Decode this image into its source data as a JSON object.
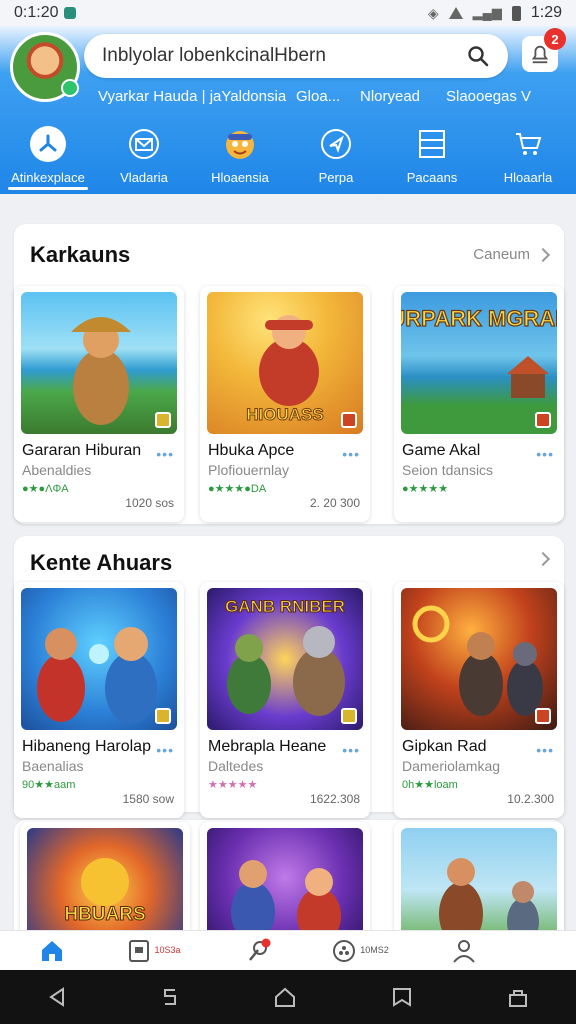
{
  "status": {
    "time_left": "0:1:20",
    "time_right": "1:29"
  },
  "search": {
    "placeholder": "Inblyolar lobenkcinalHbern"
  },
  "notifications": {
    "count": "2"
  },
  "header_links": [
    "Vyarkar Hauda | jaYaldonsia",
    "Gloa...",
    "Nloryead",
    "Slaooegas V"
  ],
  "categories": [
    {
      "label": "Atinkexplace",
      "icon": "marketplace-icon",
      "active": true
    },
    {
      "label": "Vladaria",
      "icon": "mail-icon"
    },
    {
      "label": "Hloaensia",
      "icon": "game-mascot-icon"
    },
    {
      "label": "Perpa",
      "icon": "compass-icon"
    },
    {
      "label": "Pacaans",
      "icon": "list-icon"
    },
    {
      "label": "Hloaarla",
      "icon": "cart-icon"
    }
  ],
  "sections": [
    {
      "title": "Karkauns",
      "more": "Caneum",
      "games": [
        {
          "name": "Gararan Hiburan",
          "sub": "Abenaldies",
          "rating": "●★●ΛΦA",
          "count": "1020 sos",
          "art_text": ""
        },
        {
          "name": "Hbuka Apce",
          "sub": "Plofiouernlay",
          "rating": "●★★★●DA",
          "count": "2. 20 300",
          "art_text": "HIOUASS"
        },
        {
          "name": "Game Akal",
          "sub": "Seion tdansics",
          "rating": "●★★★★",
          "count": "",
          "art_text": "KURPARK MGRAES"
        }
      ]
    },
    {
      "title": "Kente Ahuars",
      "more": "",
      "games": [
        {
          "name": "Hibaneng Harolap",
          "sub": "Baenalias",
          "rating": "90★★aam",
          "count": "1580 sow",
          "art_text": ""
        },
        {
          "name": "Mebrapla Heane",
          "sub": "Daltedes",
          "rating": "★★★★★",
          "count": "1622.308",
          "art_text": "GANB RNIBER"
        },
        {
          "name": "Gipkan Rad",
          "sub": "Dameriolamkag",
          "rating": "0h★★loam",
          "count": "10.2.300",
          "art_text": ""
        }
      ]
    },
    {
      "title": "",
      "more": "",
      "games": [
        {
          "name": "",
          "sub": "",
          "rating": "",
          "count": "",
          "art_text": "HBUARS"
        },
        {
          "name": "",
          "sub": "",
          "rating": "",
          "count": "",
          "art_text": ""
        },
        {
          "name": "",
          "sub": "",
          "rating": "",
          "count": "",
          "art_text": ""
        }
      ]
    }
  ],
  "bottom_nav": [
    {
      "label": "",
      "icon": "home-icon",
      "active": true
    },
    {
      "label": "10S3a",
      "icon": "library-icon"
    },
    {
      "label": "",
      "icon": "pin-icon"
    },
    {
      "label": "10MS2",
      "icon": "community-icon"
    },
    {
      "label": "",
      "icon": "profile-icon"
    }
  ],
  "colors": {
    "accent": "#1f86e8",
    "badge": "#e8302c",
    "rating_green": "#2b9b3e"
  }
}
